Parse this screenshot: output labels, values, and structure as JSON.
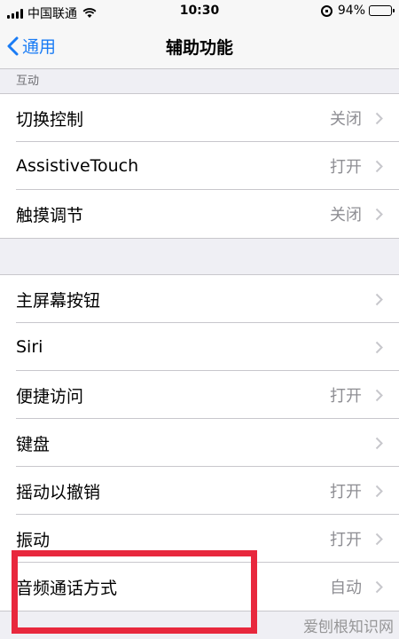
{
  "status_bar": {
    "carrier": "中国联通",
    "time": "10:30",
    "battery": "94%",
    "battery_level": 0.94,
    "icons": [
      "signal-icon",
      "wifi-icon",
      "rotation-lock-icon",
      "battery-icon"
    ]
  },
  "nav": {
    "back_label": "通用",
    "title": "辅助功能"
  },
  "sections": {
    "interaction": {
      "header": "互动",
      "rows": [
        {
          "label": "切换控制",
          "value": "关闭"
        },
        {
          "label": "AssistiveTouch",
          "value": "打开"
        },
        {
          "label": "触摸调节",
          "value": "关闭"
        }
      ]
    },
    "general": {
      "rows": [
        {
          "label": "主屏幕按钮",
          "value": ""
        },
        {
          "label": "Siri",
          "value": ""
        },
        {
          "label": "便捷访问",
          "value": "打开"
        },
        {
          "label": "键盘",
          "value": ""
        },
        {
          "label": "摇动以撤销",
          "value": "打开"
        },
        {
          "label": "振动",
          "value": "打开"
        },
        {
          "label": "音频通话方式",
          "value": "自动"
        }
      ]
    }
  },
  "watermark": "爱刨根知识网",
  "colors": {
    "accent": "#1a7cf5",
    "highlight": "#e8283d",
    "background": "#efeff4"
  }
}
